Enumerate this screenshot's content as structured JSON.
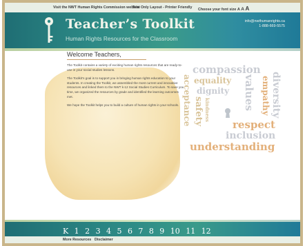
{
  "topbar": {
    "nwt_link": "Visit the NWT Human Rights Commission website",
    "text_only": "Text Only Layout - Printer Friendly",
    "font_size_label": "Choose your font size",
    "font_a_small": "A",
    "font_a_medium": "A",
    "font_a_large": "A"
  },
  "header": {
    "title": "Teacher’s Toolkit",
    "subtitle": "Human Rights Resources for the Classroom",
    "email": "info@nwthumanrights.ca",
    "phone": "1-888-669-5575"
  },
  "welcome": {
    "heading": "Welcome Teachers,",
    "p1": "The Toolkit contains a variety of exciting human rights resources that are ready-to-use in your social studies lessons.",
    "p2": "The Toolkit’s goal is to support you in bringing human rights education to your students. In creating the Toolkit, we assembled the most current and innovative resources and linked them to the NWT k-12 Social Studies Curriculum. To save you time, we organized the resources by grade and identified the learning outcomes met.",
    "p3": "We hope the Toolkit helps you to build a culture of human rights in your schools."
  },
  "word_cloud": {
    "compassion": "compassion",
    "equality": "equality",
    "dignity": "dignity",
    "acceptance": "acceptance",
    "safety": "safety",
    "kindness": "kindness",
    "values": "values",
    "empathy": "empathy",
    "diversity": "diversity",
    "respect": "respect",
    "inclusion": "inclusion",
    "understanding": "understanding",
    "colors": {
      "grey": "#c9ccd3",
      "tan": "#d9c49a",
      "orange": "#e3b07a"
    }
  },
  "grades": [
    "K",
    "1",
    "2",
    "3",
    "4",
    "5",
    "6",
    "7",
    "8",
    "9",
    "10",
    "11",
    "12"
  ],
  "footer": {
    "more_resources": "More Resources",
    "disclaimer": "Disclaimer"
  },
  "colors": {
    "header_teal": "#2d8a86",
    "frame_tan": "#c9b58a",
    "parchment": "#f6e3b4"
  }
}
